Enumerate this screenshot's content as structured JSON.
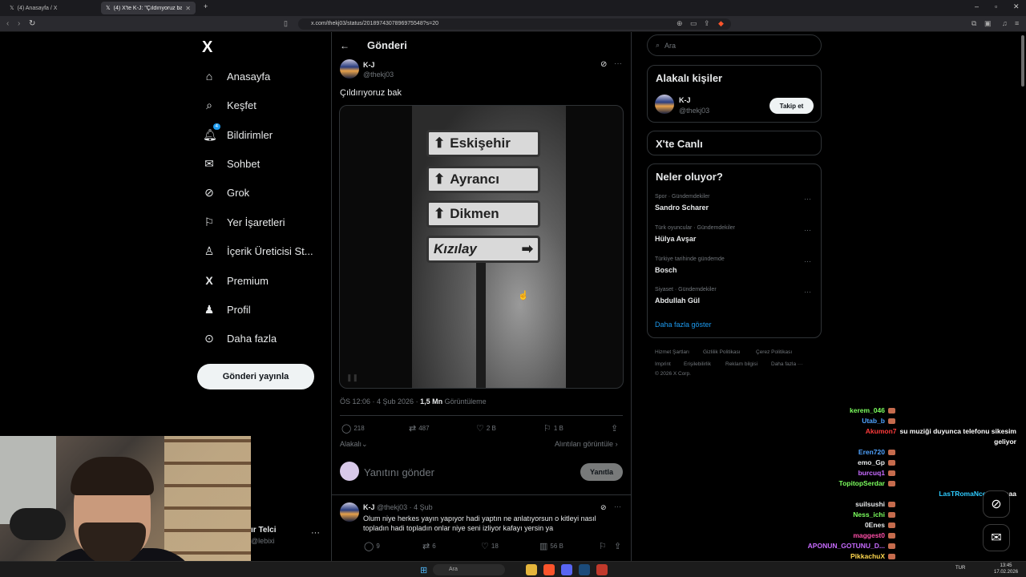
{
  "browser": {
    "tabs": [
      {
        "label": "(4) Anasayfa / X"
      },
      {
        "label": "(4) X'te K-J: \"Çıldırıyoruz bak\""
      }
    ],
    "url": "x.com/thekj03/status/2018974307896975548?s=20"
  },
  "nav": {
    "logo": "X",
    "items": [
      {
        "label": "Anasayfa",
        "icon": "home-icon"
      },
      {
        "label": "Keşfet",
        "icon": "search-icon"
      },
      {
        "label": "Bildirimler",
        "icon": "bell-icon",
        "badge": "4"
      },
      {
        "label": "Sohbet",
        "icon": "mail-icon"
      },
      {
        "label": "Grok",
        "icon": "grok-icon"
      },
      {
        "label": "Yer İşaretleri",
        "icon": "bookmark-icon"
      },
      {
        "label": "İçerik Üreticisi St...",
        "icon": "creator-icon"
      },
      {
        "label": "Premium",
        "icon": "x-premium-icon"
      },
      {
        "label": "Profil",
        "icon": "person-icon"
      },
      {
        "label": "Daha fazla",
        "icon": "more-circle-icon"
      }
    ],
    "post_button": "Gönderi yayınla",
    "account": {
      "name": "ır Telci",
      "handle": "@lebixi"
    }
  },
  "post": {
    "header_title": "Gönderi",
    "author_name": "K-J",
    "author_handle": "@thekj03",
    "text": "Çıldırıyoruz bak",
    "signs": [
      "Eskişehir",
      "Ayrancı",
      "Dikmen",
      "Kızılay"
    ],
    "time": "ÖS 12:06 · 4 Şub 2026 · ",
    "views_count": "1,5 Mn",
    "views_label": " Görüntüleme",
    "stats": {
      "replies": "218",
      "reposts": "487",
      "likes": "2 B",
      "bookmarks": "1 B"
    },
    "sort_label": "Alakalı",
    "quotes_link": "Alıntıları görüntüle",
    "reply_placeholder": "Yanıtını gönder",
    "reply_button": "Yanıtla"
  },
  "comment": {
    "name": "K-J",
    "handle_date": " @thekj03 · 4 Şub",
    "text": "Olum niye herkes  yayın yapıyor hadi yaptın ne anlatıyorsun o kitleyi nasıl topladın hadi topladın onlar niye seni izliyor kafayı yersin ya",
    "stats": {
      "replies": "9",
      "reposts": "6",
      "likes": "18",
      "views": "56 B"
    }
  },
  "sidebar": {
    "search_placeholder": "Ara",
    "related_title": "Alakalı kişiler",
    "related_person": {
      "name": "K-J",
      "handle": "@thekj03",
      "follow": "Takip et"
    },
    "live_title": "X'te Canlı",
    "trends_title": "Neler oluyor?",
    "trends": [
      {
        "category": "Spor · Gündemdekiler",
        "name": "Sandro Scharer"
      },
      {
        "category": "Türk oyuncular · Gündemdekiler",
        "name": "Hülya Avşar"
      },
      {
        "category": "Türkiye tarihinde gündemde",
        "name": "Bosch"
      },
      {
        "category": "Siyaset · Gündemdekiler",
        "name": "Abdullah Gül"
      }
    ],
    "show_more": "Daha fazla göster",
    "footer": [
      "Hizmet Şartları",
      "Gizlilik Politikası",
      "Çerez Politikası",
      "Imprint",
      "Erişilebilirlik",
      "Reklam bilgisi",
      "Daha fazla ···",
      "© 2026 X Corp."
    ]
  },
  "chat": [
    {
      "user": "kerem_046",
      "color": "#7cff5e",
      "msg": ""
    },
    {
      "user": "Utab_b",
      "color": "#4fa3ff",
      "msg": ""
    },
    {
      "user": "Akumon7",
      "color": "#ff3b3b",
      "msg": "su muziği duyunca telefonu sikesim"
    },
    {
      "user": "",
      "color": "#ffffff",
      "msg": "geliyor"
    },
    {
      "user": "Eren720",
      "color": "#4fa3ff",
      "msg": ""
    },
    {
      "user": "emo_Gp",
      "color": "#e7e9ea",
      "msg": ""
    },
    {
      "user": "burcuq1",
      "color": "#c86bff",
      "msg": ""
    },
    {
      "user": "TopitopSerdar",
      "color": "#7cff5e",
      "msg": ""
    },
    {
      "user": "LasTRomaNce56",
      "color": "#2ecbff",
      "msg": "Yaaaa"
    },
    {
      "user": "suilsushi",
      "color": "#e7e9ea",
      "msg": ""
    },
    {
      "user": "Ness_ichi",
      "color": "#7cff5e",
      "msg": ""
    },
    {
      "user": "0Enes",
      "color": "#e7e9ea",
      "msg": ""
    },
    {
      "user": "maggest0",
      "color": "#ff4fa8",
      "msg": ""
    },
    {
      "user": "APONUN_GOTUNU_D...",
      "color": "#c86bff",
      "msg": ""
    },
    {
      "user": "PikkachuX",
      "color": "#ffd84f",
      "msg": ""
    }
  ],
  "taskbar": {
    "search": "Ara",
    "lang": "TUR",
    "time": "13:45",
    "date": "17.02.2026"
  }
}
